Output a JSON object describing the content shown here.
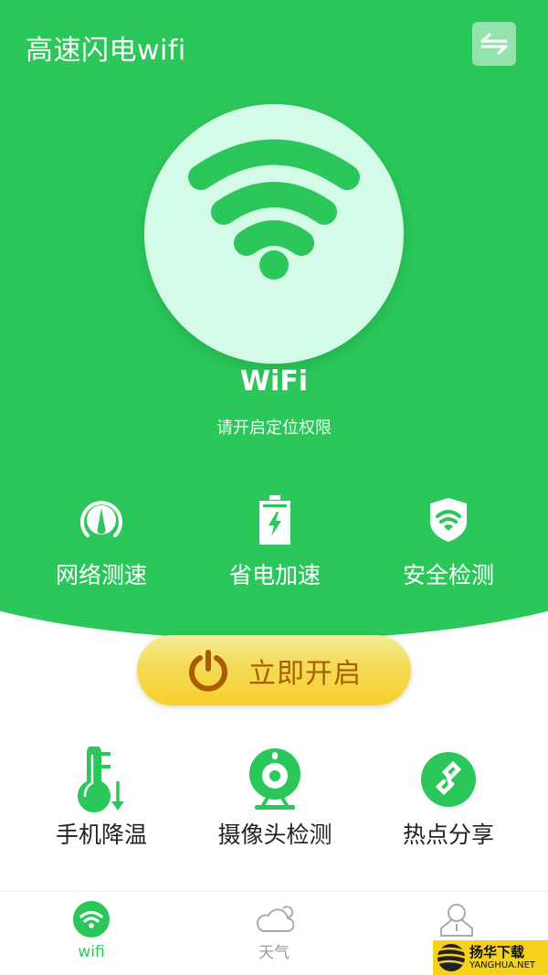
{
  "colors": {
    "brand": "#2bc75a",
    "circle": "#d4fbe8",
    "button_text": "#a85e00"
  },
  "header": {
    "title": "高速闪电wifi",
    "switch_icon": "swap-arrows-icon"
  },
  "status": {
    "title": "WiFi",
    "subtitle": "请开启定位权限",
    "icon": "wifi-icon"
  },
  "top_features": [
    {
      "label": "网络测速",
      "icon": "speedometer-icon"
    },
    {
      "label": "省电加速",
      "icon": "battery-charging-icon"
    },
    {
      "label": "安全检测",
      "icon": "shield-wifi-icon"
    }
  ],
  "start_button": {
    "label": "立即开启",
    "icon": "power-icon"
  },
  "bottom_features": [
    {
      "label": "手机降温",
      "icon": "thermometer-down-icon"
    },
    {
      "label": "摄像头检测",
      "icon": "webcam-icon"
    },
    {
      "label": "热点分享",
      "icon": "link-icon"
    }
  ],
  "tabbar": [
    {
      "label": "wifi",
      "icon": "wifi-icon",
      "active": true
    },
    {
      "label": "天气",
      "icon": "cloud-icon",
      "active": false
    },
    {
      "label": "",
      "icon": "user-icon",
      "active": false
    }
  ],
  "watermark": {
    "cn": "扬华下载",
    "en": "YANGHUA.NET"
  }
}
